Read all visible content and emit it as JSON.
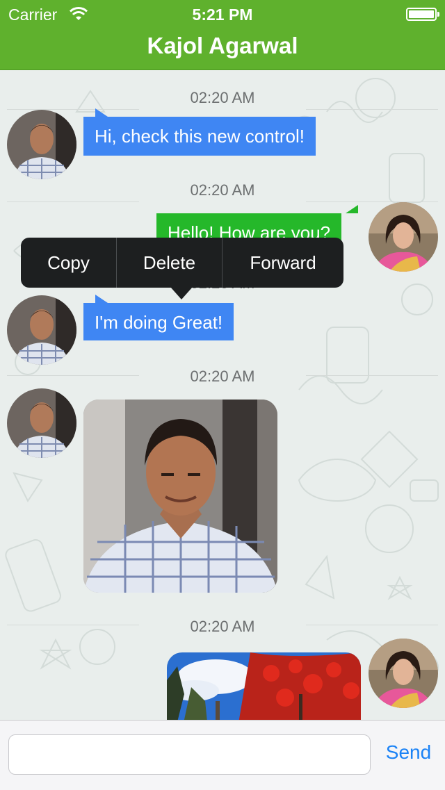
{
  "status_bar": {
    "carrier": "Carrier",
    "time": "5:21 PM",
    "wifi_icon": "wifi-icon",
    "battery_icon": "battery-icon"
  },
  "header": {
    "title": "Kajol Agarwal",
    "color": "#5fb12d"
  },
  "messages": [
    {
      "timestamp": "02:20 AM",
      "side": "left",
      "type": "text",
      "text": "Hi, check this new control!",
      "avatar": "male-avatar"
    },
    {
      "timestamp": "02:20 AM",
      "side": "right",
      "type": "text",
      "text": "Hello! How are you?",
      "avatar": "female-avatar"
    },
    {
      "timestamp": "02:20 AM",
      "side": "left",
      "type": "text",
      "text": "I'm doing Great!",
      "avatar": "male-avatar"
    },
    {
      "timestamp": "02:20 AM",
      "side": "left",
      "type": "image",
      "image": "portrait-photo",
      "avatar": "male-avatar"
    },
    {
      "timestamp": "02:20 AM",
      "side": "right",
      "type": "image",
      "image": "autumn-forest-photo",
      "avatar": "female-avatar"
    }
  ],
  "context_menu": {
    "items": [
      "Copy",
      "Delete",
      "Forward"
    ]
  },
  "composer": {
    "placeholder": "",
    "value": "",
    "send_label": "Send",
    "send_color": "#1a82f6"
  },
  "colors": {
    "incoming_bubble": "#3f86f3",
    "outgoing_bubble": "#25b82a"
  }
}
